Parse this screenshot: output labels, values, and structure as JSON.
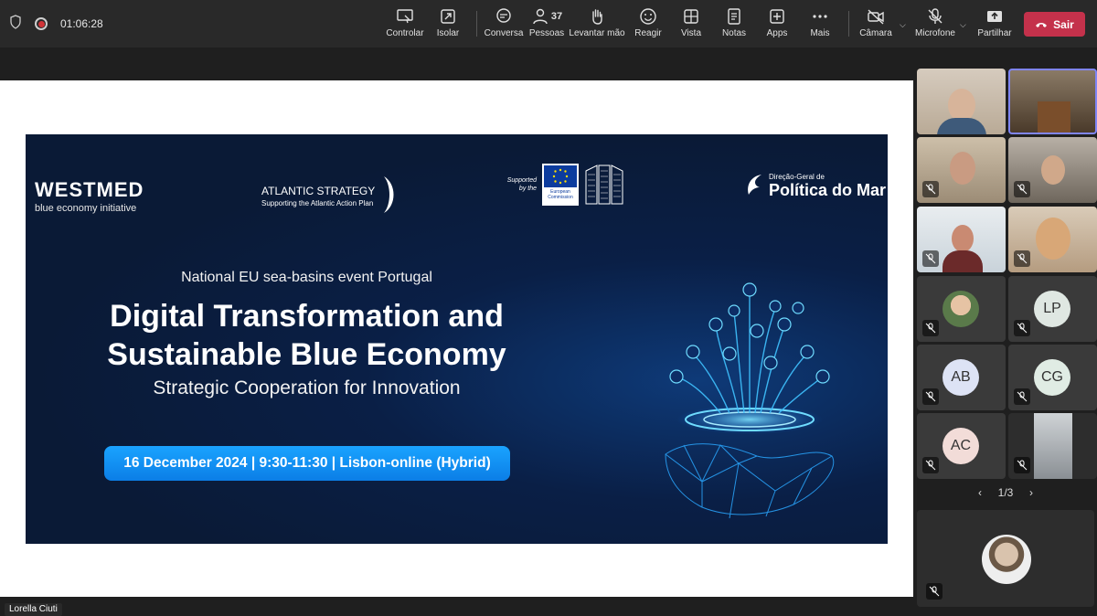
{
  "topbar": {
    "timer": "01:06:28",
    "tools": [
      {
        "id": "control",
        "label": "Controlar",
        "icon": "control-icon"
      },
      {
        "id": "isolate",
        "label": "Isolar",
        "icon": "isolate-icon"
      },
      {
        "id": "chat",
        "label": "Conversa",
        "icon": "chat-icon"
      },
      {
        "id": "people",
        "label": "Pessoas",
        "icon": "people-icon",
        "count": "37"
      },
      {
        "id": "raise",
        "label": "Levantar mão",
        "icon": "raise-hand-icon"
      },
      {
        "id": "react",
        "label": "Reagir",
        "icon": "react-icon"
      },
      {
        "id": "view",
        "label": "Vista",
        "icon": "view-icon"
      },
      {
        "id": "notes",
        "label": "Notas",
        "icon": "notes-icon"
      },
      {
        "id": "apps",
        "label": "Apps",
        "icon": "apps-icon"
      },
      {
        "id": "more",
        "label": "Mais",
        "icon": "more-icon"
      },
      {
        "id": "camera",
        "label": "Câmara",
        "icon": "camera-off-icon"
      },
      {
        "id": "mic",
        "label": "Microfone",
        "icon": "mic-off-icon"
      },
      {
        "id": "share",
        "label": "Partilhar",
        "icon": "share-icon"
      }
    ],
    "leave_label": "Sair",
    "leave_color": "#c4314b"
  },
  "slide": {
    "westmed_title": "WESTMED",
    "westmed_sub": "blue economy initiative",
    "atlantic_title": "ATLANTIC STRATEGY",
    "atlantic_sub": "Supporting the Atlantic Action Plan",
    "eu_supported": "Supported by the",
    "eu_commission": "European Commission",
    "dgpm_small": "Direção-Geral de",
    "dgpm_big": "Política do Mar",
    "event_sub": "National EU sea-basins event Portugal",
    "event_title_1": "Digital Transformation and",
    "event_title_2": "Sustainable Blue Economy",
    "event_tagline": "Strategic Cooperation for Innovation",
    "event_date": "16 December 2024 | 9:30-11:30 | Lisbon-online (Hybrid)"
  },
  "gallery": {
    "tiles": [
      {
        "kind": "video",
        "muted": false
      },
      {
        "kind": "video",
        "muted": false
      },
      {
        "kind": "video",
        "muted": true
      },
      {
        "kind": "video",
        "muted": true
      },
      {
        "kind": "video",
        "muted": true
      },
      {
        "kind": "video",
        "muted": true
      },
      {
        "kind": "photo",
        "muted": true
      },
      {
        "kind": "initials",
        "initials": "LP",
        "muted": true
      },
      {
        "kind": "initials",
        "initials": "AB",
        "muted": true
      },
      {
        "kind": "initials",
        "initials": "CG",
        "muted": true
      },
      {
        "kind": "initials",
        "initials": "AC",
        "muted": true
      },
      {
        "kind": "photo",
        "muted": true
      }
    ],
    "pager": "1/3"
  },
  "presenter_name": "Lorella Ciuti"
}
